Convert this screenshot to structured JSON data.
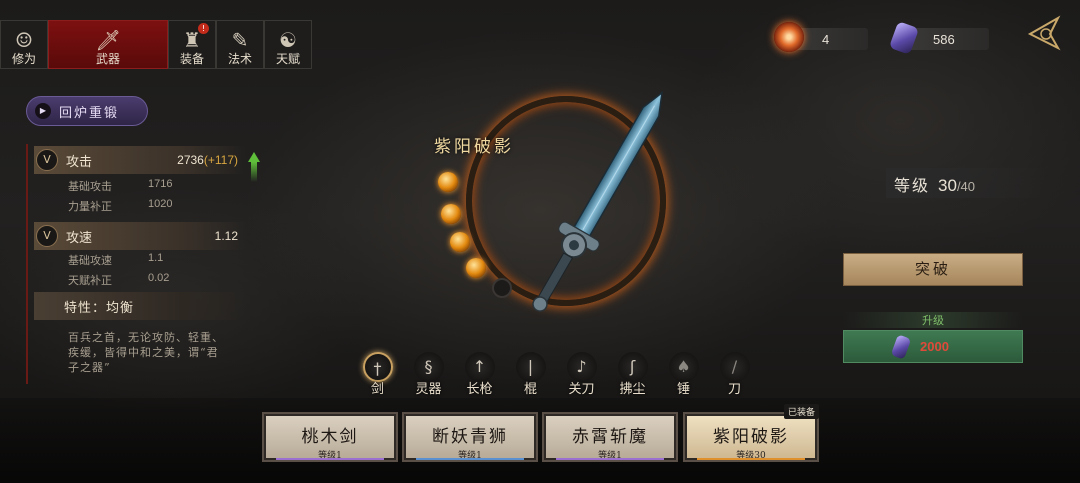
{
  "tabs": [
    {
      "label": "修为",
      "icon": "cultivator-icon"
    },
    {
      "label": "武器",
      "icon": "sword-icon",
      "active": true
    },
    {
      "label": "装备",
      "icon": "armor-icon",
      "badge": "!"
    },
    {
      "label": "法术",
      "icon": "talisman-icon"
    },
    {
      "label": "天赋",
      "icon": "yin-yang-icon"
    }
  ],
  "currency": {
    "fire_orb": "4",
    "crystal": "586"
  },
  "reforge_label": "回炉重锻",
  "stats": {
    "attack": {
      "label": "攻击",
      "value": "2736",
      "bonus": "(+117)",
      "subs": [
        {
          "label": "基础攻击",
          "value": "1716"
        },
        {
          "label": "力量补正",
          "value": "1020"
        }
      ]
    },
    "speed": {
      "label": "攻速",
      "value": "1.12",
      "subs": [
        {
          "label": "基础攻速",
          "value": "1.1"
        },
        {
          "label": "天赋补正",
          "value": "0.02"
        }
      ]
    },
    "trait": "特性：均衡",
    "trait_desc": "百兵之首，无论攻防、轻重、疾缓，皆得中和之美，谓“君子之器”"
  },
  "weapon": {
    "name": "紫阳破影",
    "orbs_filled": 4,
    "orbs_total": 5
  },
  "level": {
    "label": "等级",
    "current": "30",
    "max": "/40"
  },
  "breakthrough_label": "突破",
  "upgrade": {
    "label": "升级",
    "cost": "2000"
  },
  "categories": [
    {
      "label": "剑",
      "icon": "sword-icon",
      "active": true
    },
    {
      "label": "灵器",
      "icon": "spirit-item-icon"
    },
    {
      "label": "长枪",
      "icon": "spear-icon"
    },
    {
      "label": "棍",
      "icon": "staff-icon"
    },
    {
      "label": "关刀",
      "icon": "guandao-icon"
    },
    {
      "label": "拂尘",
      "icon": "whisk-icon"
    },
    {
      "label": "锤",
      "icon": "hammer-icon",
      "dim": true
    },
    {
      "label": "刀",
      "icon": "sabre-icon",
      "dim": true
    }
  ],
  "cards": [
    {
      "name": "桃木剑",
      "level": "等级1",
      "bar_color": "#9b6fd0"
    },
    {
      "name": "断妖青狮",
      "level": "等级1",
      "bar_color": "#5a8fd0"
    },
    {
      "name": "赤霄斩魔",
      "level": "等级1",
      "bar_color": "#9b6fd0"
    },
    {
      "name": "紫阳破影",
      "level": "等级30",
      "bar_color": "#e0902a",
      "equipped": true,
      "tag": "已装备"
    }
  ]
}
